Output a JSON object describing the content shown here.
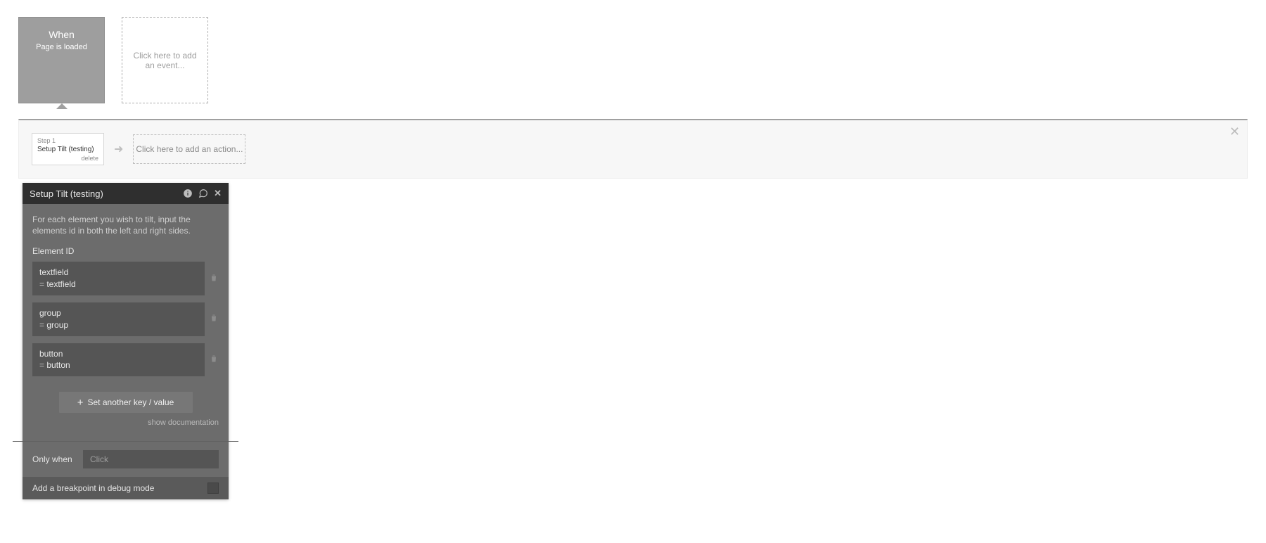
{
  "event": {
    "when_label": "When",
    "event_text": "Page is loaded",
    "add_event_text": "Click here to add an event..."
  },
  "action_strip": {
    "step": {
      "num_label": "Step 1",
      "title": "Setup Tilt (testing)",
      "delete_label": "delete"
    },
    "add_action_text": "Click here to add an action..."
  },
  "panel": {
    "title": "Setup Tilt (testing)",
    "description": "For each element you wish to tilt, input the elements id in both the left and right sides.",
    "element_id_label": "Element ID",
    "items": [
      {
        "key": "textfield",
        "value": "textfield"
      },
      {
        "key": "group",
        "value": "group"
      },
      {
        "key": "button",
        "value": "button"
      }
    ],
    "add_kv_label": "Set another key / value",
    "doc_link_label": "show documentation",
    "only_when_label": "Only when",
    "only_when_placeholder": "Click",
    "breakpoint_label": "Add a breakpoint in debug mode"
  }
}
